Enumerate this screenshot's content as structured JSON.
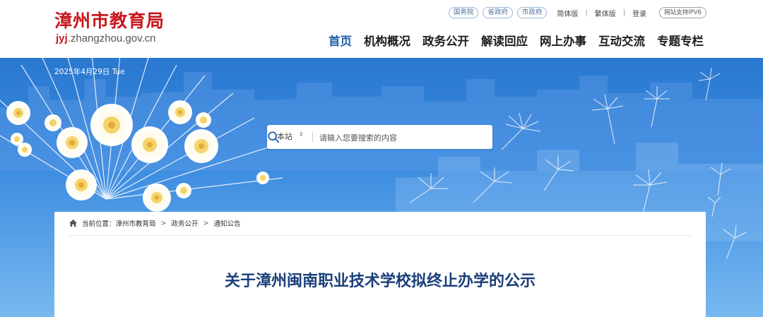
{
  "site": {
    "name_cn": "漳州市教育局",
    "domain_prefix": "jyj",
    "domain_rest": ".zhangzhou.gov.cn"
  },
  "toplinks": {
    "pills": [
      "国务院",
      "省政府",
      "市政府"
    ],
    "simplified": "简体版",
    "traditional": "繁体版",
    "login": "登录",
    "separator": "|",
    "ipv6": "网站支持IPV6"
  },
  "nav": {
    "items": [
      {
        "label": "首页",
        "active": true
      },
      {
        "label": "机构概况",
        "active": false
      },
      {
        "label": "政务公开",
        "active": false
      },
      {
        "label": "解读回应",
        "active": false
      },
      {
        "label": "网上办事",
        "active": false
      },
      {
        "label": "互动交流",
        "active": false
      },
      {
        "label": "专题专栏",
        "active": false
      }
    ]
  },
  "banner": {
    "date": "2025年4月29日 Tue"
  },
  "search": {
    "scope": "本站",
    "scope_arrow": "⇕",
    "placeholder": "请输入您要搜索的内容",
    "icon": "search-icon"
  },
  "breadcrumb": {
    "label": "当前位置：",
    "items": [
      "漳州市教育局",
      "政务公开",
      "通知公告"
    ],
    "arrow": ">"
  },
  "article": {
    "title": "关于漳州闽南职业技术学校拟终止办学的公示"
  },
  "colors": {
    "brand_red": "#c8161d",
    "nav_active": "#1e5ea8",
    "title_blue": "#1a3f7a",
    "banner_blue": "#2a78cf"
  }
}
